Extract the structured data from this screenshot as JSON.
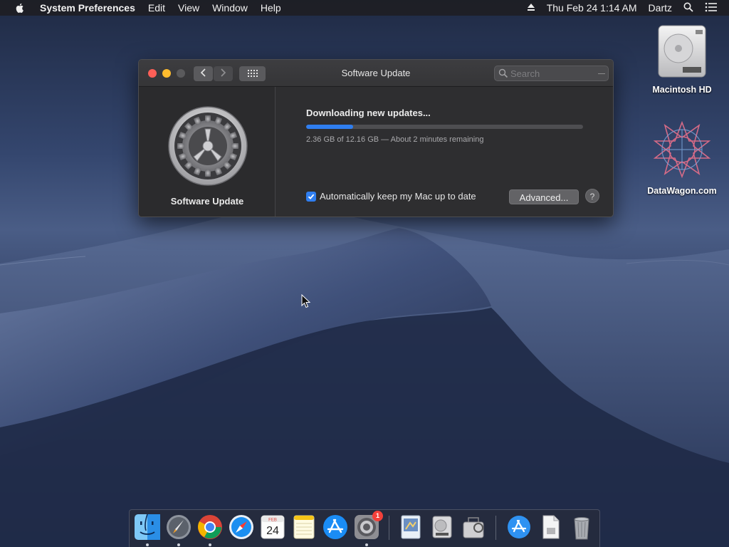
{
  "menubar": {
    "app_name": "System Preferences",
    "menus": [
      "Edit",
      "View",
      "Window",
      "Help"
    ],
    "datetime": "Thu Feb 24  1:14 AM",
    "user": "Dartz"
  },
  "desktop": {
    "icons": [
      {
        "label": "Macintosh HD",
        "icon": "hard-drive-icon"
      },
      {
        "label": "DataWagon.com",
        "icon": "datawagon-logo-icon"
      }
    ]
  },
  "window": {
    "title": "Software Update",
    "search_placeholder": "Search",
    "sidebar_title": "Software Update",
    "status_title": "Downloading new updates...",
    "progress_fraction": 0.17,
    "progress_detail": "2.36 GB of 12.16 GB — About 2 minutes remaining",
    "auto_update_label": "Automatically keep my Mac up to date",
    "auto_update_checked": true,
    "advanced_label": "Advanced...",
    "help_label": "?"
  },
  "dock": {
    "badge_count": "1",
    "calendar_month": "FEB",
    "calendar_day": "24",
    "apps": [
      "finder",
      "launchpad",
      "chrome",
      "safari",
      "calendar",
      "notes",
      "app-store",
      "system-preferences",
      "preview",
      "disk-utility",
      "archive-utility",
      "app-store-download",
      "document",
      "trash"
    ]
  },
  "colors": {
    "accent": "#2f7ef0",
    "window_bg": "#2e2e30",
    "menubar_bg": "#1e1e22"
  }
}
